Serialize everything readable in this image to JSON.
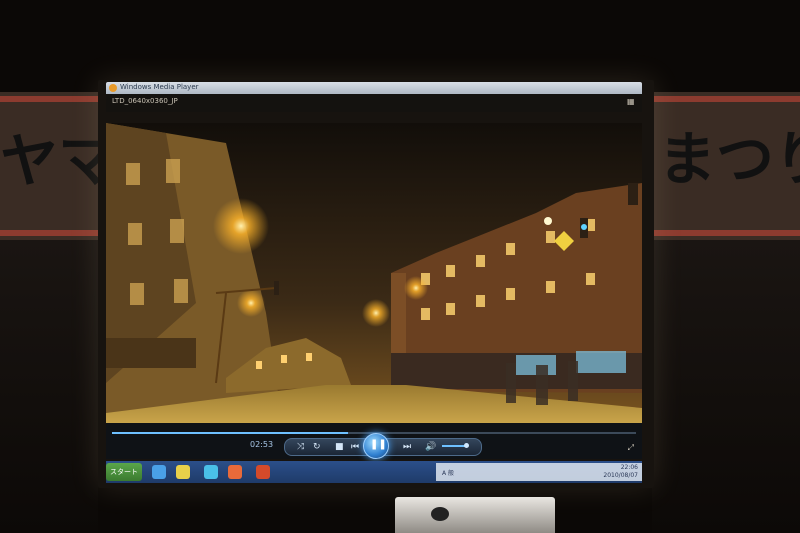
{
  "window": {
    "title": "Windows Media Player",
    "file_name": "LTD_0640x0360_JP"
  },
  "playback": {
    "elapsed": "02:53",
    "progress": 0.45,
    "volume": 0.9
  },
  "taskbar": {
    "start_label": "スタート",
    "tray_text": "A 般",
    "clock_time": "22:06",
    "clock_date": "2010/08/07"
  },
  "backdrop": {
    "banner_left_text": "ヤマ",
    "banner_right_text": "まつり"
  },
  "colors": {
    "accent": "#6ec0ff",
    "sodium_light": "#ffb52a"
  },
  "icons": {
    "shuffle": "shuffle-icon",
    "repeat": "repeat-icon",
    "stop": "stop-icon",
    "previous": "previous-icon",
    "play_pause": "pause-icon",
    "next": "next-icon",
    "volume": "speaker-icon"
  }
}
